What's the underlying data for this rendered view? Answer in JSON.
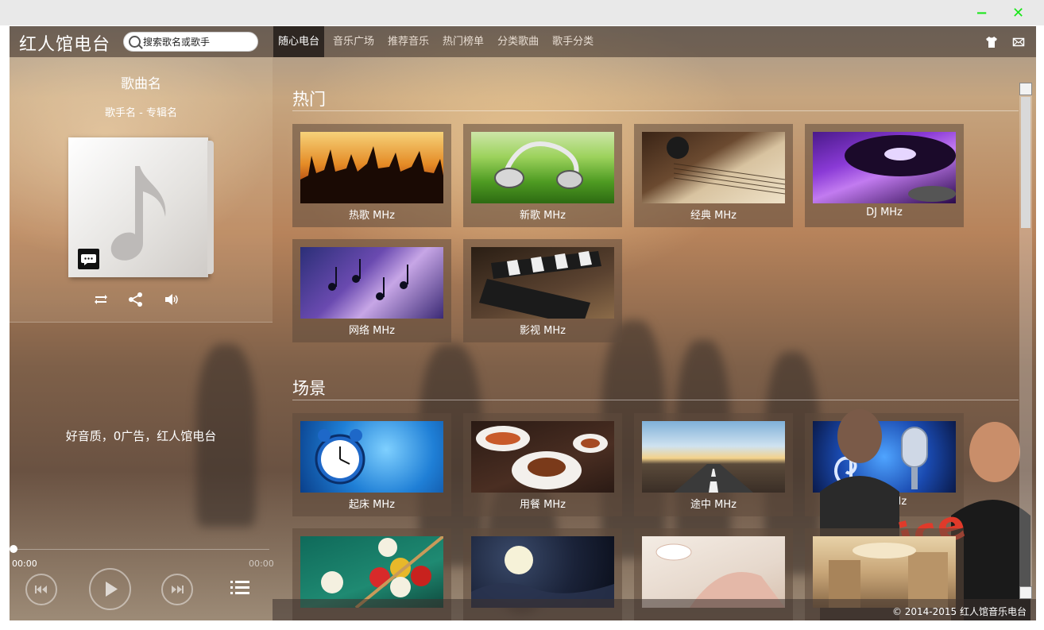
{
  "window": {
    "minimize": "−",
    "close": "✕"
  },
  "header": {
    "logo": "红人馆电台",
    "search_placeholder": "搜索歌名或歌手",
    "tabs": [
      {
        "label": "随心电台",
        "active": true
      },
      {
        "label": "音乐广场"
      },
      {
        "label": "推荐音乐"
      },
      {
        "label": "热门榜单"
      },
      {
        "label": "分类歌曲"
      },
      {
        "label": "歌手分类"
      }
    ],
    "icons": [
      "skin-shirt-icon",
      "mail-icon"
    ]
  },
  "player": {
    "song_name": "歌曲名",
    "artist_album": "歌手名  - 专辑名",
    "slogan": "好音质，0广告，红人馆电台",
    "time_current": "00:00",
    "time_total": "00:00",
    "progress": 0,
    "icons": [
      "repeat-icon",
      "share-icon",
      "volume-icon",
      "comment-icon",
      "prev-icon",
      "play-icon",
      "next-icon",
      "playlist-icon"
    ]
  },
  "sections": [
    {
      "title": "热门",
      "cards": [
        {
          "label": "热歌  MHz",
          "icon": "concert-crowd-image"
        },
        {
          "label": "新歌  MHz",
          "icon": "headphones-grass-image"
        },
        {
          "label": "经典  MHz",
          "icon": "sheet-music-image"
        },
        {
          "label": "DJ MHz",
          "icon": "turntable-image"
        },
        {
          "label": "网络  MHz",
          "icon": "music-notes-galaxy-image"
        },
        {
          "label": "影视  MHz",
          "icon": "clapperboard-image"
        }
      ]
    },
    {
      "title": "场景",
      "cards": [
        {
          "label": "起床  MHz",
          "icon": "alarm-clock-image"
        },
        {
          "label": "用餐  MHz",
          "icon": "dining-plates-image"
        },
        {
          "label": "途中  MHz",
          "icon": "road-horizon-image"
        },
        {
          "label": "KTV MHz",
          "icon": "microphone-image"
        },
        {
          "label": "",
          "icon": "billiards-image"
        },
        {
          "label": "",
          "icon": "moon-night-image"
        },
        {
          "label": "",
          "icon": "reading-image"
        },
        {
          "label": "",
          "icon": "interior-image"
        }
      ]
    }
  ],
  "footer": {
    "copyright": "© 2014-2015 红人馆音乐电台"
  },
  "colors": {
    "window_controls": "#19e619",
    "active_tab": "#1a1512",
    "card_bg": "#5f4b3c"
  }
}
